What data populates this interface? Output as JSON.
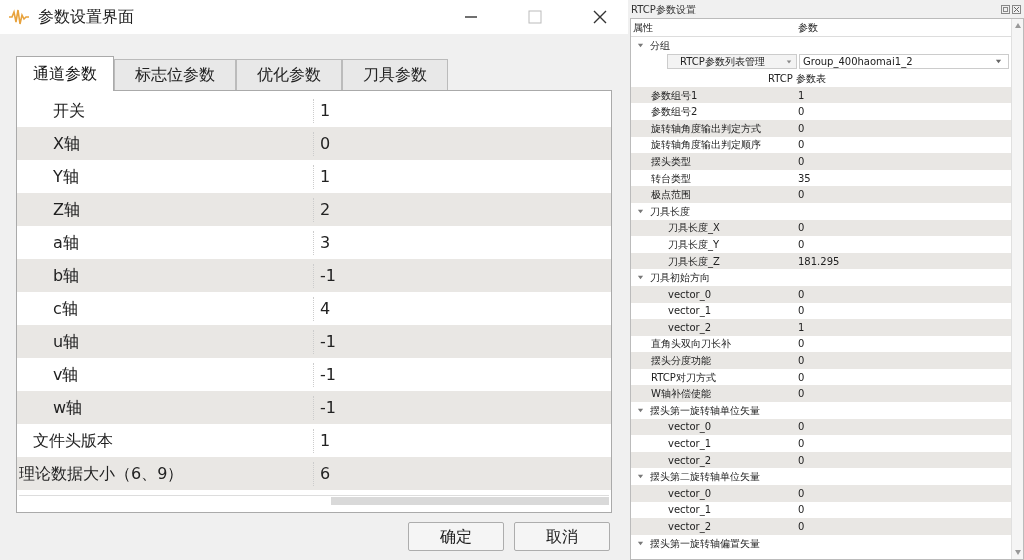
{
  "dialog": {
    "title": "参数设置界面",
    "tabs": [
      {
        "label": "通道参数",
        "selected": true
      },
      {
        "label": "标志位参数",
        "selected": false
      },
      {
        "label": "优化参数",
        "selected": false
      },
      {
        "label": "刀具参数",
        "selected": false
      }
    ],
    "rows": [
      {
        "kind": "deep",
        "label": "开关",
        "value": "1"
      },
      {
        "kind": "deep",
        "label": "X轴",
        "value": "0"
      },
      {
        "kind": "deep",
        "label": "Y轴",
        "value": "1"
      },
      {
        "kind": "deep",
        "label": "Z轴",
        "value": "2"
      },
      {
        "kind": "deep",
        "label": "a轴",
        "value": "3"
      },
      {
        "kind": "deep",
        "label": "b轴",
        "value": "-1"
      },
      {
        "kind": "deep",
        "label": "c轴",
        "value": "4"
      },
      {
        "kind": "deep",
        "label": "u轴",
        "value": "-1"
      },
      {
        "kind": "deep",
        "label": "v轴",
        "value": "-1"
      },
      {
        "kind": "deep",
        "label": "w轴",
        "value": "-1"
      },
      {
        "kind": "mid",
        "label": "文件头版本",
        "value": "1"
      },
      {
        "kind": "flush",
        "label": "理论数据大小（6、9）",
        "value": "6"
      }
    ],
    "buttons": [
      "确定",
      "取消"
    ]
  },
  "rtcp_panel": {
    "title": "RTCP参数设置",
    "columns": [
      "属性",
      "参数"
    ],
    "group": {
      "label": "分组",
      "expanded": true,
      "list_selector": "RTCP参数列表管理",
      "group_selector": "Group_400haomai1_2"
    },
    "table_title": "RTCP 参数表",
    "items": [
      {
        "label": "参数组号1",
        "value": "1"
      },
      {
        "label": "参数组号2",
        "value": "0"
      },
      {
        "label": "旋转轴角度输出判定方式",
        "value": "0"
      },
      {
        "label": "旋转轴角度输出判定顺序",
        "value": "0"
      },
      {
        "label": "摆头类型",
        "value": "0"
      },
      {
        "label": "转台类型",
        "value": "35"
      },
      {
        "label": "极点范围",
        "value": "0"
      },
      {
        "label": "刀具长度",
        "expanded": true,
        "children": [
          {
            "label": "刀具长度_X",
            "value": "0"
          },
          {
            "label": "刀具长度_Y",
            "value": "0"
          },
          {
            "label": "刀具长度_Z",
            "value": "181.295"
          }
        ]
      },
      {
        "label": "刀具初始方向",
        "expanded": true,
        "children": [
          {
            "label": "vector_0",
            "value": "0"
          },
          {
            "label": "vector_1",
            "value": "0"
          },
          {
            "label": "vector_2",
            "value": "1"
          }
        ]
      },
      {
        "label": "直角头双向刀长补",
        "value": "0"
      },
      {
        "label": "摆头分度功能",
        "value": "0"
      },
      {
        "label": "RTCP对刀方式",
        "value": "0"
      },
      {
        "label": "W轴补偿使能",
        "value": "0"
      },
      {
        "label": "摆头第一旋转轴单位矢量",
        "expanded": true,
        "children": [
          {
            "label": "vector_0",
            "value": "0"
          },
          {
            "label": "vector_1",
            "value": "0"
          },
          {
            "label": "vector_2",
            "value": "0"
          }
        ]
      },
      {
        "label": "摆头第二旋转轴单位矢量",
        "expanded": true,
        "children": [
          {
            "label": "vector_0",
            "value": "0"
          },
          {
            "label": "vector_1",
            "value": "0"
          },
          {
            "label": "vector_2",
            "value": "0"
          }
        ]
      },
      {
        "label": "摆头第一旋转轴偏置矢量",
        "expanded": true
      }
    ]
  }
}
